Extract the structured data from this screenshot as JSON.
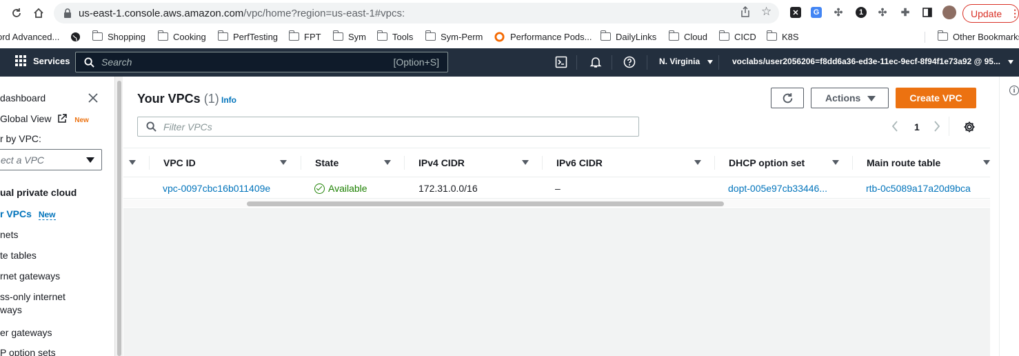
{
  "browser": {
    "url_host": "us-east-1.console.aws.amazon.com",
    "url_path": "/vpc/home?region=us-east-1#vpcs:",
    "update_label": "Update"
  },
  "bookmarks": [
    {
      "label": "ord Advanced..."
    },
    {
      "label": ""
    },
    {
      "label": "Shopping"
    },
    {
      "label": "Cooking"
    },
    {
      "label": "PerfTesting"
    },
    {
      "label": "FPT"
    },
    {
      "label": "Sym"
    },
    {
      "label": "Tools"
    },
    {
      "label": "Sym-Perm"
    },
    {
      "label": "Performance Pods..."
    },
    {
      "label": "DailyLinks"
    },
    {
      "label": "Cloud"
    },
    {
      "label": "CICD"
    },
    {
      "label": "K8S"
    },
    {
      "label": "Other Bookmarks"
    }
  ],
  "aws_header": {
    "services_label": "Services",
    "search_placeholder": "Search",
    "search_shortcut": "[Option+S]",
    "region": "N. Virginia",
    "account": "voclabs/user2056206=f8dd6a36-ed3e-11ec-9ecf-8f94f1e73a92 @ 95..."
  },
  "sidebar": {
    "dashboard": "dashboard",
    "global_view": "Global View",
    "new_badge": "New",
    "filter_label": "r by VPC:",
    "select_placeholder": "ect a VPC",
    "section": "ual private cloud",
    "your_vpcs": "r VPCs",
    "your_vpcs_badge": "New",
    "subnets": "nets",
    "route_tables": "te tables",
    "internet_gateways": "rnet gateways",
    "egress_line1": "ss-only internet",
    "egress_line2": "ways",
    "carrier_gateways": "er gateways",
    "dhcp": "P option sets"
  },
  "main": {
    "title": "Your VPCs",
    "count": "(1)",
    "info": "Info",
    "actions_label": "Actions",
    "create_label": "Create VPC",
    "filter_placeholder": "Filter VPCs",
    "page_number": "1",
    "columns": [
      "VPC ID",
      "State",
      "IPv4 CIDR",
      "IPv6 CIDR",
      "DHCP option set",
      "Main route table"
    ],
    "rows": [
      {
        "vpc_id": "vpc-0097cbc16b011409e",
        "state": "Available",
        "ipv4": "172.31.0.0/16",
        "ipv6": "–",
        "dhcp": "dopt-005e97cb33446...",
        "route_table": "rtb-0c5089a17a20d9bca"
      }
    ]
  },
  "colors": {
    "aws_header": "#232f3e",
    "accent_orange": "#ec7211",
    "link_blue": "#0073bb",
    "status_green": "#1d8102",
    "new_badge": "#ec7211"
  }
}
